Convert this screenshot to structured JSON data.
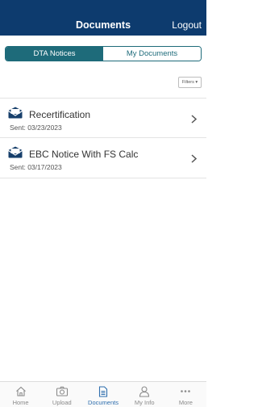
{
  "header": {
    "title": "Documents",
    "logout_label": "Logout",
    "background_color": "#0d3b6e"
  },
  "segments": {
    "active_label": "DTA Notices",
    "inactive_label": "My Documents",
    "accent_color": "#1e6b7a"
  },
  "filters": {
    "label": "Filters ▾"
  },
  "documents": [
    {
      "title": "Recertification",
      "sent": "Sent: 03/23/2023",
      "icon": "envelope-icon"
    },
    {
      "title": "EBC Notice With FS Calc",
      "sent": "Sent: 03/17/2023",
      "icon": "envelope-icon"
    }
  ],
  "tabbar": {
    "items": [
      {
        "label": "Home",
        "icon": "home-icon",
        "active": false
      },
      {
        "label": "Upload",
        "icon": "camera-icon",
        "active": false
      },
      {
        "label": "Documents",
        "icon": "document-icon",
        "active": true
      },
      {
        "label": "My Info",
        "icon": "person-icon",
        "active": false
      },
      {
        "label": "More",
        "icon": "more-dots-icon",
        "active": false
      }
    ]
  }
}
